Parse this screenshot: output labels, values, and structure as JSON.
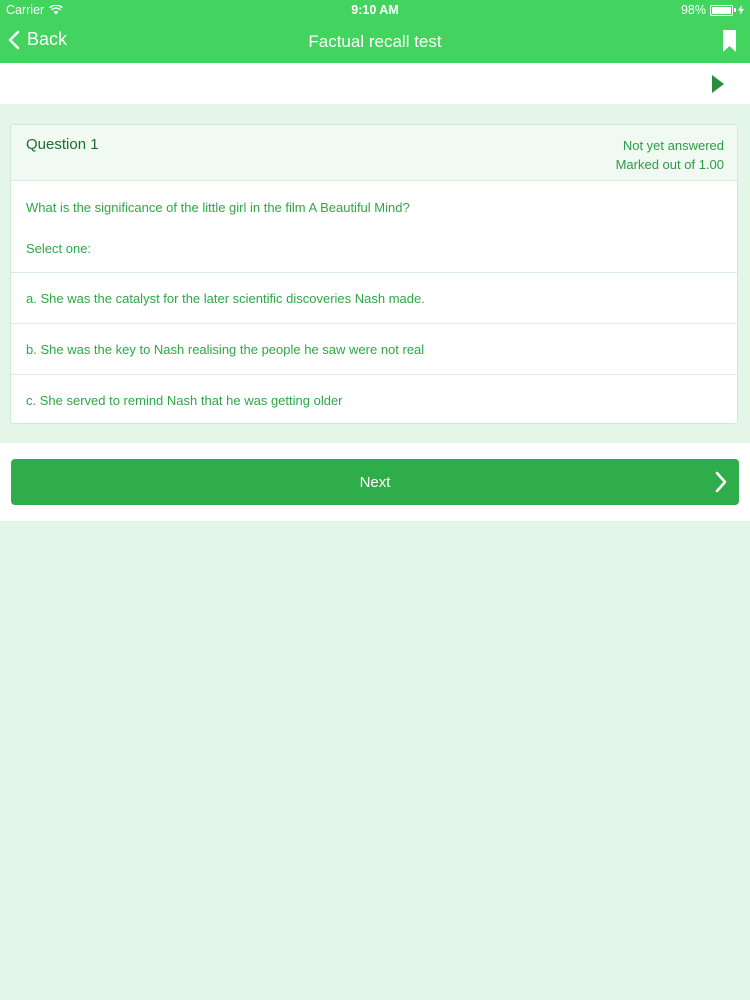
{
  "status_bar": {
    "carrier": "Carrier",
    "time": "9:10 AM",
    "battery_text": "98%",
    "battery_level": 0.98
  },
  "nav": {
    "back_label": "Back",
    "title": "Factual recall test"
  },
  "question": {
    "number_label": "Question 1",
    "status": "Not yet answered",
    "marks": "Marked out of 1.00",
    "text": "What is the significance of the little girl in the film A Beautiful Mind?",
    "select_label": "Select one:",
    "options": [
      {
        "label": "a. She was the catalyst for the later scientific discoveries Nash made."
      },
      {
        "label": "b. She was the key to Nash realising the people he saw were not real"
      },
      {
        "label": "c. She served to remind Nash that he was getting older"
      }
    ]
  },
  "footer": {
    "next_label": "Next"
  },
  "colors": {
    "accent": "#43d35f",
    "button": "#2fad4a",
    "background": "#e4f6e8",
    "text_green": "#2ea746"
  },
  "icons": {
    "back": "chevron-left-icon",
    "bookmark": "bookmark-icon",
    "play": "play-icon",
    "next": "chevron-right-icon",
    "wifi": "wifi-icon",
    "battery": "battery-icon",
    "charging": "charging-bolt-icon"
  }
}
